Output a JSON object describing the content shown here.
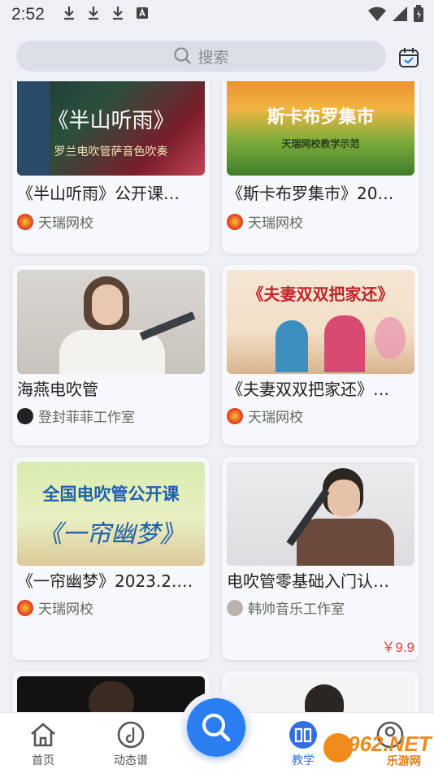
{
  "status_bar": {
    "time": "2:52"
  },
  "search": {
    "placeholder": "搜索"
  },
  "cards": [
    {
      "title": "《半山听雨》公开课…",
      "author": "天瑞网校",
      "thumb_main": "《半山听雨》",
      "thumb_sub": "罗兰电吹管萨音色吹奏"
    },
    {
      "title": "《斯卡布罗集市》20…",
      "author": "天瑞网校",
      "thumb_main": "斯卡布罗集市",
      "thumb_sub": "天瑞网校教学示范"
    },
    {
      "title": "海燕电吹管",
      "author": "登封菲菲工作室"
    },
    {
      "title": "《夫妻双双把家还》…",
      "author": "天瑞网校",
      "thumb_main": "《夫妻双双把家还》"
    },
    {
      "title": "《一帘幽梦》2023.2.…",
      "author": "天瑞网校",
      "thumb_main": "全国电吹管公开课",
      "thumb_sub": "《一帘幽梦》"
    },
    {
      "title": "电吹管零基础入门认…",
      "author": "韩帅音乐工作室",
      "price": "￥9.9"
    }
  ],
  "nav": {
    "home": "首页",
    "dynamic_score": "动态谱",
    "teaching": "教学"
  },
  "watermark": {
    "brand": "962.NET",
    "sub": "乐游网"
  },
  "colors": {
    "accent": "#2a7ef0",
    "price": "#e4453a",
    "brand_orange": "#f08b1c"
  }
}
